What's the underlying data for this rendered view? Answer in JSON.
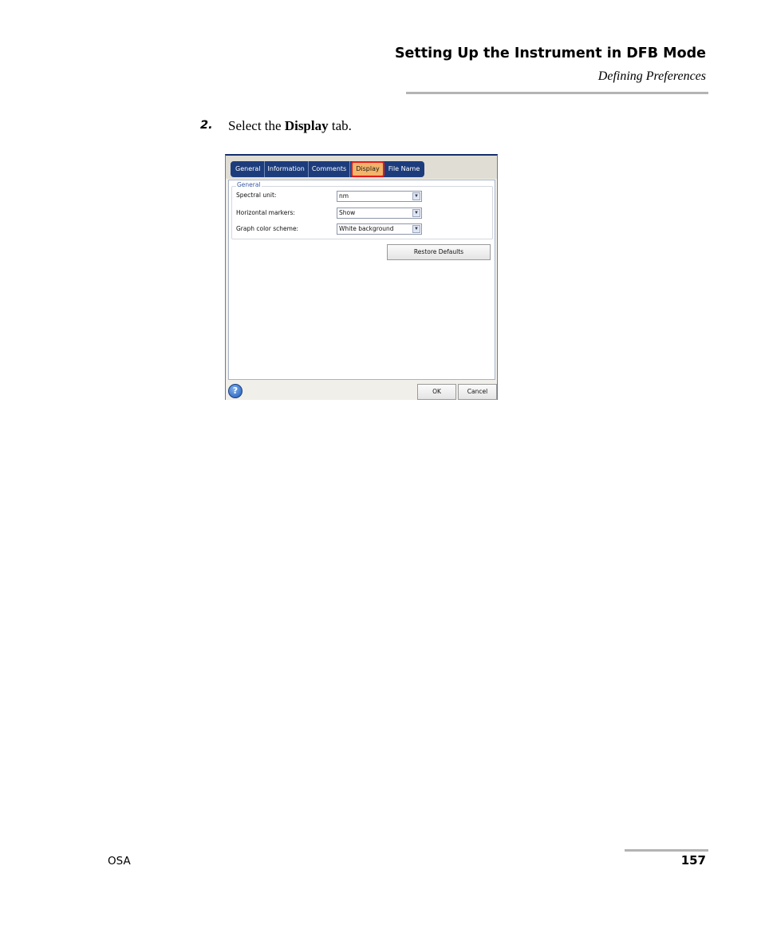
{
  "header": {
    "title": "Setting Up the Instrument in DFB Mode",
    "subtitle": "Defining Preferences"
  },
  "step": {
    "number": "2.",
    "text_before": "Select the ",
    "text_bold": "Display",
    "text_after": " tab."
  },
  "dialog": {
    "tabs": [
      "General",
      "Information",
      "Comments",
      "Display",
      "File Name"
    ],
    "active_tab": "Display",
    "group_label": "General",
    "fields": [
      {
        "label": "Spectral unit:",
        "value": "nm"
      },
      {
        "label": "Horizontal markers:",
        "value": "Show"
      },
      {
        "label": "Graph color scheme:",
        "value": "White background"
      }
    ],
    "restore_defaults_label": "Restore Defaults",
    "help_icon": "question-mark-icon",
    "ok_label": "OK",
    "cancel_label": "Cancel",
    "highlight_color": "#e21b1b"
  },
  "footer": {
    "left": "OSA",
    "page": "157"
  }
}
